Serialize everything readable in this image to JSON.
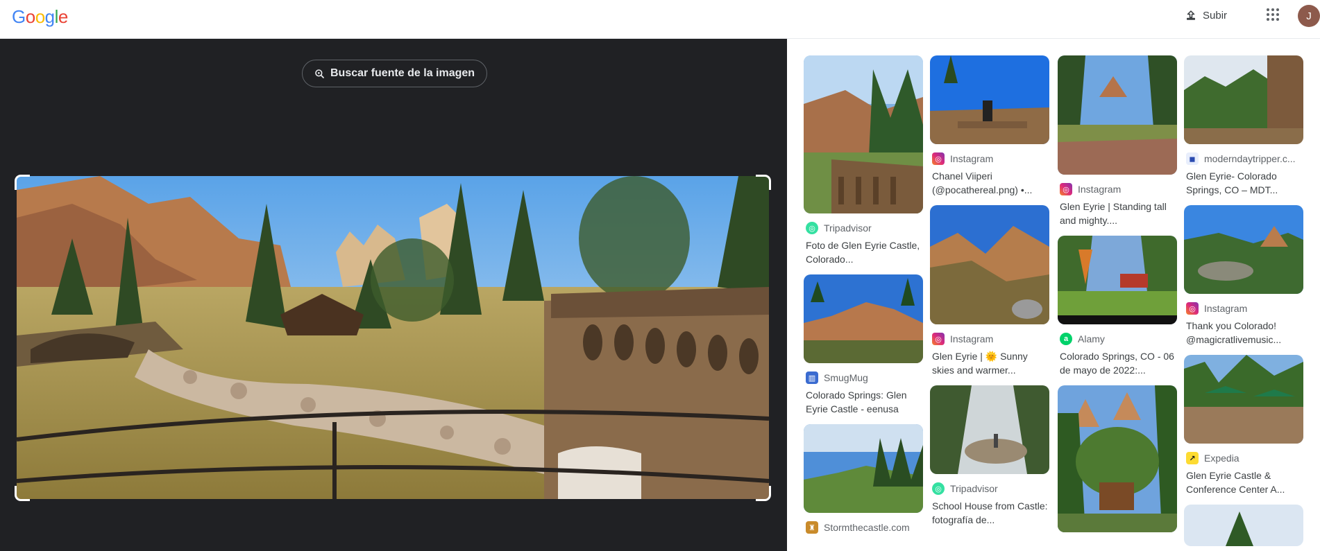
{
  "header": {
    "logo": [
      "G",
      "o",
      "o",
      "g",
      "l",
      "e"
    ],
    "logo_colors": [
      "#4285f4",
      "#ea4335",
      "#fbbc05",
      "#4285f4",
      "#34a853",
      "#ea4335"
    ],
    "upload_label": "Subir",
    "avatar_initial": "J"
  },
  "lens": {
    "find_source_label": "Buscar fuente de la imagen",
    "photo_icon": "landscape-photo"
  },
  "results": {
    "col1": [
      {
        "source": "Tripadvisor",
        "icon": "tripadvisor-icon",
        "title": "Foto de Glen Eyrie Castle, Colorado..."
      },
      {
        "source": "SmugMug",
        "icon": "smugmug-icon",
        "title": "Colorado Springs: Glen Eyrie Castle - eenusa"
      },
      {
        "source": "Stormthecastle.com",
        "icon": "stormthecastle-icon",
        "title": ""
      }
    ],
    "col2": [
      {
        "source": "Instagram",
        "icon": "instagram-icon",
        "title": "Chanel Viiperi (@pocathereal.png) •..."
      },
      {
        "source": "Instagram",
        "icon": "instagram-icon",
        "title": "Glen Eyrie | 🌞 Sunny skies and warmer..."
      },
      {
        "source": "Tripadvisor",
        "icon": "tripadvisor-icon",
        "title": "School House from Castle: fotografía de..."
      }
    ],
    "col3": [
      {
        "source": "Instagram",
        "icon": "instagram-icon",
        "title": "Glen Eyrie | Standing tall and mighty...."
      },
      {
        "source": "Alamy",
        "icon": "alamy-icon",
        "title": "Colorado Springs, CO - 06 de mayo de 2022:..."
      },
      {
        "source": "",
        "icon": "",
        "title": ""
      }
    ],
    "col4": [
      {
        "source": "moderndaytripper.c...",
        "icon": "moderndaytripper-icon",
        "title": "Glen Eyrie- Colorado Springs, CO – MDT..."
      },
      {
        "source": "Instagram",
        "icon": "instagram-icon",
        "title": "Thank you Colorado! @magicratlivemusic..."
      },
      {
        "source": "Expedia",
        "icon": "expedia-icon",
        "title": "Glen Eyrie Castle & Conference Center A..."
      }
    ]
  },
  "colors": {
    "dark_panel": "#202124",
    "tripadvisor": "#34e0a1",
    "instagram": "#e1306c",
    "smugmug": "#3a6bd0",
    "alamy": "#00d26a",
    "expedia": "#fddb32"
  }
}
